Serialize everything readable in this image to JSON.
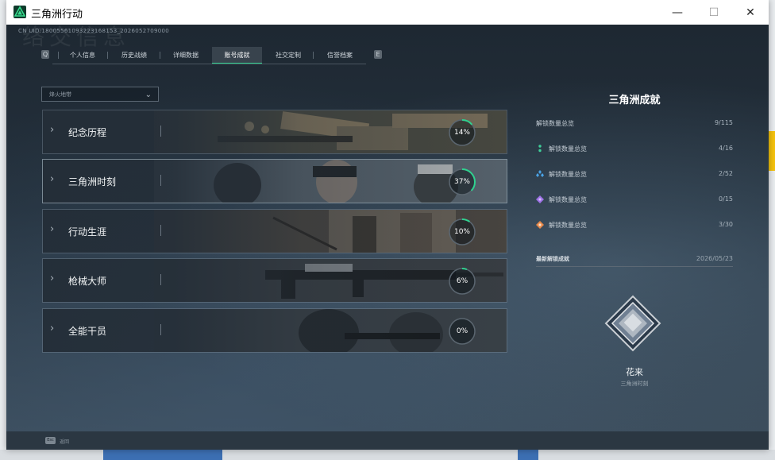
{
  "window": {
    "title": "三角洲行动",
    "minimize": "—",
    "maximize": "☐",
    "close": "✕"
  },
  "header": {
    "bg_title": "络交信息",
    "cn_uid": "CN UID:18005561093223168153_2026052709000"
  },
  "tabs": [
    {
      "label": "个人信息",
      "active": false
    },
    {
      "label": "历史战绩",
      "active": false
    },
    {
      "label": "详细数据",
      "active": false
    },
    {
      "label": "账号成就",
      "active": true
    },
    {
      "label": "社交定制",
      "active": false
    },
    {
      "label": "信誉档案",
      "active": false
    }
  ],
  "tab_nav": {
    "prev": "Q",
    "next": "E"
  },
  "filter": {
    "label": "烽火地带"
  },
  "categories": [
    {
      "label": "纪念历程",
      "progress": 14,
      "progress_text": "14%"
    },
    {
      "label": "三角洲时刻",
      "progress": 37,
      "progress_text": "37%"
    },
    {
      "label": "行动生涯",
      "progress": 10,
      "progress_text": "10%"
    },
    {
      "label": "枪械大师",
      "progress": 6,
      "progress_text": "6%"
    },
    {
      "label": "全能干员",
      "progress": 0,
      "progress_text": "0%"
    }
  ],
  "panel": {
    "title": "三角洲成就",
    "total": {
      "label": "解锁数量总览",
      "value": "9/115"
    },
    "tiers": [
      {
        "label": "解锁数量总览",
        "value": "4/16",
        "icon": "green-tier-icon",
        "color": "#3fcf9a"
      },
      {
        "label": "解锁数量总览",
        "value": "2/52",
        "icon": "blue-tier-icon",
        "color": "#4aa3e6"
      },
      {
        "label": "解锁数量总览",
        "value": "0/15",
        "icon": "purple-tier-icon",
        "color": "#a073e8"
      },
      {
        "label": "解锁数量总览",
        "value": "3/30",
        "icon": "orange-tier-icon",
        "color": "#e8894a"
      }
    ],
    "latest": {
      "label": "最新解锁成就",
      "date": "2026/05/23"
    },
    "badge": {
      "name": "花来",
      "category": "三角洲时刻"
    }
  },
  "footer": {
    "key": "Esc",
    "label": "返回"
  },
  "colors": {
    "accent": "#2fd18f",
    "background": "#1d2731"
  }
}
